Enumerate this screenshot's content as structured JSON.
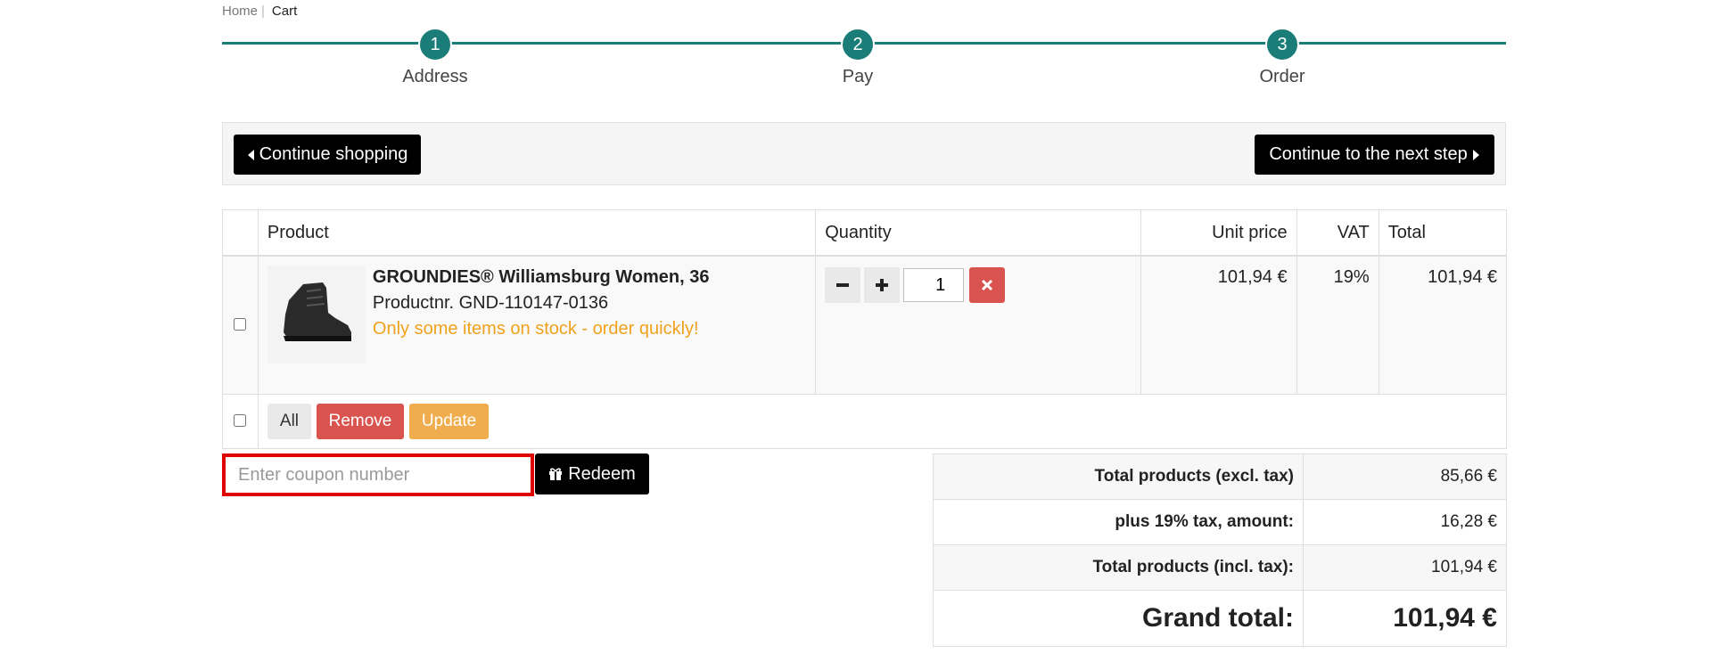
{
  "breadcrumb": {
    "home": "Home",
    "separator": "|",
    "current": "Cart"
  },
  "steps": [
    {
      "number": "1",
      "label": "Address"
    },
    {
      "number": "2",
      "label": "Pay"
    },
    {
      "number": "3",
      "label": "Order"
    }
  ],
  "toolbar": {
    "continue_shopping": "Continue shopping",
    "next_step": "Continue to the next step"
  },
  "table": {
    "headers": {
      "product": "Product",
      "quantity": "Quantity",
      "unit_price": "Unit price",
      "vat": "VAT",
      "total": "Total"
    },
    "item": {
      "name": "GROUNDIES® Williamsburg Women, 36",
      "product_number": "Productnr. GND-110147-0136",
      "stock_notice": "Only some items on stock - order quickly!",
      "quantity": "1",
      "unit_price": "101,94 €",
      "vat": "19%",
      "total": "101,94 €",
      "image_icon": "shoe-image"
    },
    "actions": {
      "all": "All",
      "remove": "Remove",
      "update": "Update"
    }
  },
  "coupon": {
    "placeholder": "Enter coupon number",
    "redeem": "Redeem",
    "redeem_icon": "gift-icon"
  },
  "totals": {
    "excl_label": "Total products (excl. tax)",
    "excl_value": "85,66 €",
    "tax_label": "plus 19% tax, amount:",
    "tax_value": "16,28 €",
    "incl_label": "Total products (incl. tax):",
    "incl_value": "101,94 €",
    "grand_label": "Grand total:",
    "grand_value": "101,94 €"
  },
  "colors": {
    "accent": "#1a7d78",
    "danger": "#d9534f",
    "warning": "#f0ad4e",
    "stock": "#f0a21d",
    "highlight": "#e00000"
  }
}
